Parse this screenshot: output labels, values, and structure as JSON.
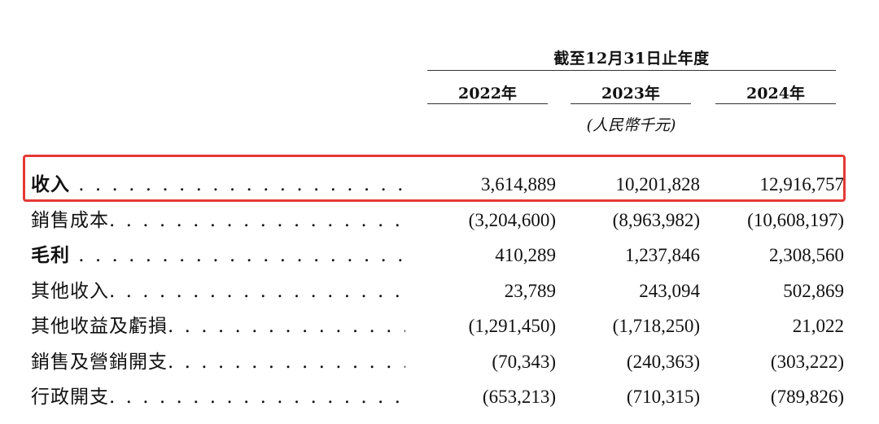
{
  "header": {
    "period": "截至12月31日止年度",
    "years": [
      "2022年",
      "2023年",
      "2024年"
    ],
    "currency": "(人民幣千元)"
  },
  "rows": [
    {
      "label": "收入",
      "bold": true,
      "dots": " . . . . . . . . . . . . . . . . . . . . . . . . . . . . . . .",
      "values": [
        "3,614,889",
        "10,201,828",
        "12,916,757"
      ]
    },
    {
      "label": "銷售成本",
      "bold": false,
      "dots": ". . . . . . . . . . . . . . . . . . . . . . . . . . . . . . .",
      "values": [
        "(3,204,600)",
        "(8,963,982)",
        "(10,608,197)"
      ]
    },
    {
      "label": "毛利",
      "bold": true,
      "dots": " . . . . . . . . . . . . . . . . . . . . . . . . . . . . . . .",
      "values": [
        "410,289",
        "1,237,846",
        "2,308,560"
      ]
    },
    {
      "label": "其他收入",
      "bold": false,
      "dots": ". . . . . . . . . . . . . . . . . . . . . . . . . . . . . . .",
      "values": [
        "23,789",
        "243,094",
        "502,869"
      ]
    },
    {
      "label": "其他收益及虧損",
      "bold": false,
      "dots": ". . . . . . . . . . . . . . . . . . . . . . . . . . .",
      "values": [
        "(1,291,450)",
        "(1,718,250)",
        "21,022"
      ]
    },
    {
      "label": "銷售及營銷開支",
      "bold": false,
      "dots": ". . . . . . . . . . . . . . . . . . . . . . . . . . .",
      "values": [
        "(70,343)",
        "(240,363)",
        "(303,222)"
      ]
    },
    {
      "label": "行政開支",
      "bold": false,
      "dots": ". . . . . . . . . . . . . . . . . . . . . . . . . . . . . . .",
      "values": [
        "(653,213)",
        "(710,315)",
        "(789,826)"
      ]
    }
  ],
  "highlight": {
    "row": "收入",
    "color": "#e53935"
  }
}
